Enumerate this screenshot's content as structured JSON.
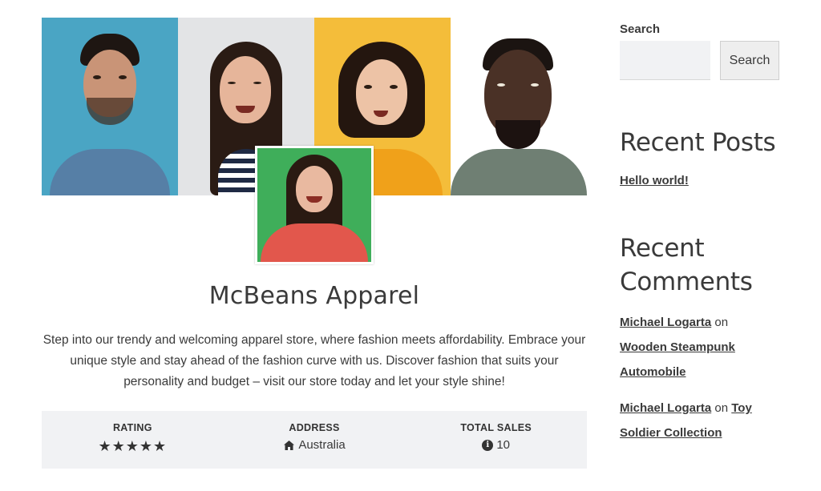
{
  "store": {
    "name": "McBeans Apparel",
    "description": "Step into our trendy and welcoming apparel store, where fashion meets affordability. Embrace your unique style and stay ahead of the fashion curve with us. Discover fashion that suits your personality and budget – visit our store today and let your style shine!"
  },
  "info": {
    "rating_label": "RATING",
    "rating_stars": 5,
    "address_label": "ADDRESS",
    "address_value": "Australia",
    "sales_label": "TOTAL SALES",
    "sales_value": "10"
  },
  "sidebar": {
    "search_label": "Search",
    "search_button": "Search",
    "recent_posts_title": "Recent Posts",
    "posts": [
      "Hello world!"
    ],
    "recent_comments_title": "Recent Comments",
    "comments": [
      {
        "author": "Michael Logarta",
        "sep": " on ",
        "post": "Wooden Steampunk Automobile"
      },
      {
        "author": "Michael Logarta",
        "sep": " on ",
        "post": "Toy Soldier Collection"
      }
    ]
  },
  "colors": {
    "photo1_bg": "#4aa5c4",
    "photo2_bg": "#e3e4e6",
    "photo3_bg": "#f4bd3a",
    "photo4_bg": "#ffffff",
    "avatar_bg": "#3fae5a",
    "info_bar_bg": "#f1f2f4"
  }
}
